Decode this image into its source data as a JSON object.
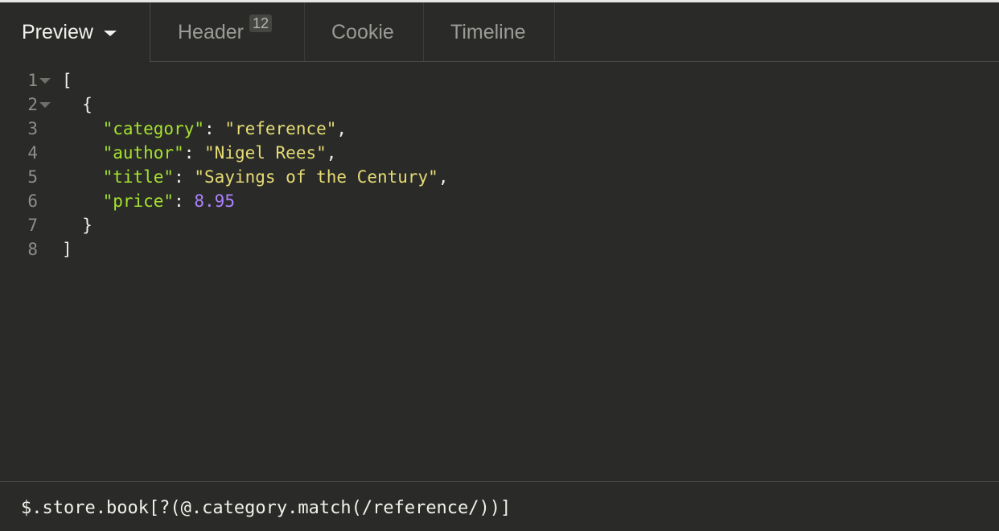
{
  "tabs": {
    "preview": {
      "label": "Preview"
    },
    "header": {
      "label": "Header",
      "badge": "12"
    },
    "cookie": {
      "label": "Cookie"
    },
    "timeline": {
      "label": "Timeline"
    }
  },
  "editor": {
    "lines": [
      {
        "number": "1",
        "foldable": true
      },
      {
        "number": "2",
        "foldable": true
      },
      {
        "number": "3",
        "key": "\"category\"",
        "value": "\"reference\""
      },
      {
        "number": "4",
        "key": "\"author\"",
        "value": "\"Nigel Rees\""
      },
      {
        "number": "5",
        "key": "\"title\"",
        "value": "\"Sayings of the Century\""
      },
      {
        "number": "6",
        "key": "\"price\"",
        "value": "8.95"
      },
      {
        "number": "7"
      },
      {
        "number": "8"
      }
    ]
  },
  "filter": {
    "value": "$.store.book[?(@.category.match(/reference/))]"
  },
  "colors": {
    "background": "#2a2b28",
    "key": "#a6e22e",
    "string": "#e6db74",
    "number": "#ae81ff"
  },
  "icons": {
    "preview_dropdown": "caret-down-icon",
    "fold": "fold-arrow-icon"
  }
}
